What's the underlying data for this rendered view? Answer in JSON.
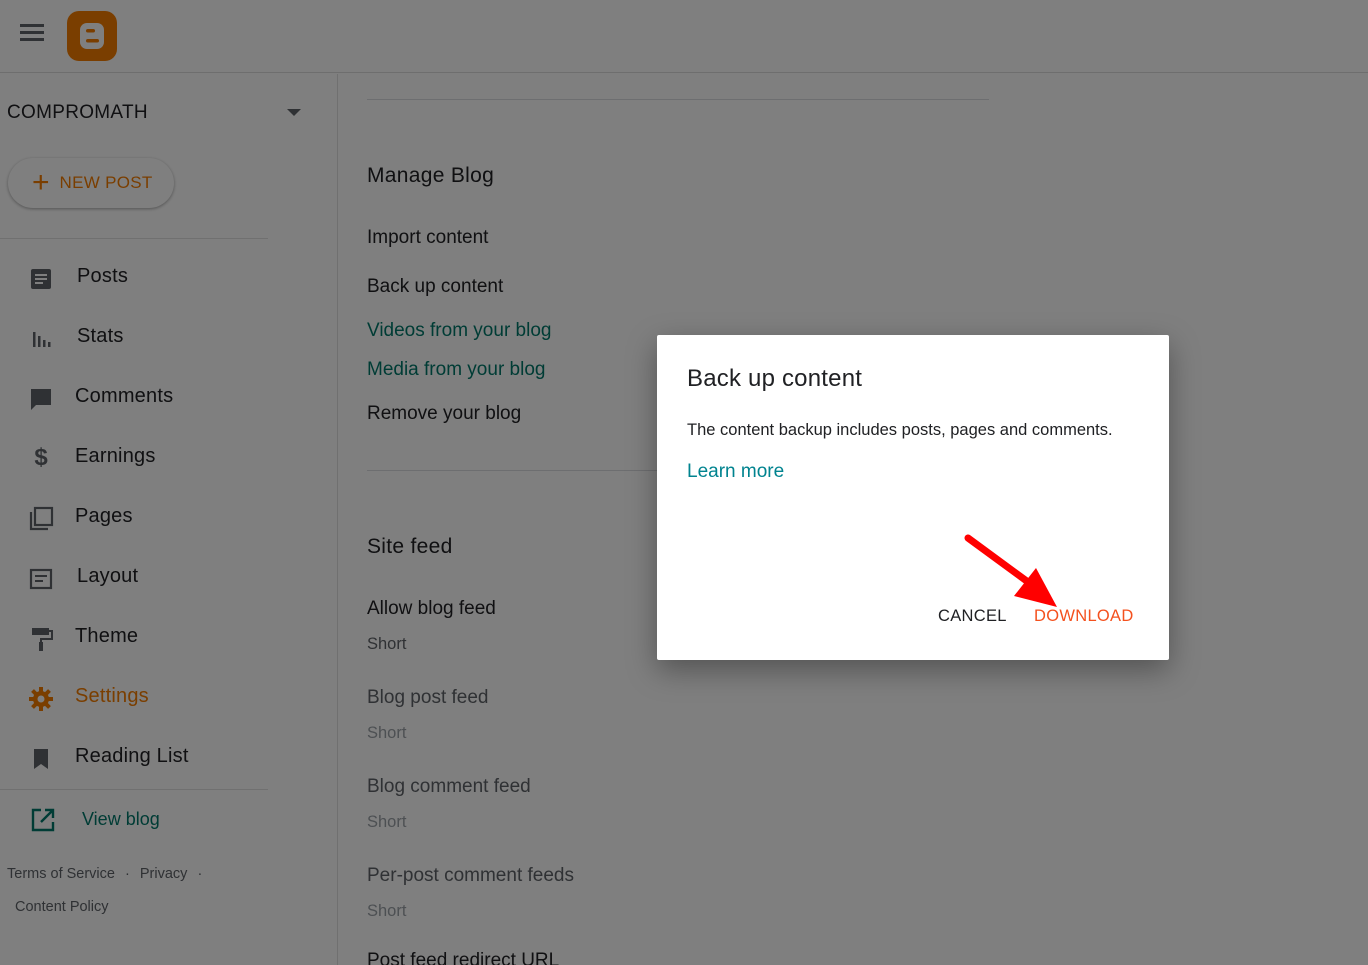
{
  "header": {
    "menu_icon": "hamburger-menu-icon",
    "logo_icon": "blogger-logo-icon"
  },
  "sidebar": {
    "blog_name": "COMPROMATH",
    "new_post_label": "NEW POST",
    "items": [
      {
        "label": "Posts",
        "icon": "posts-icon"
      },
      {
        "label": "Stats",
        "icon": "stats-icon"
      },
      {
        "label": "Comments",
        "icon": "comments-icon"
      },
      {
        "label": "Earnings",
        "icon": "dollar-icon"
      },
      {
        "label": "Pages",
        "icon": "pages-icon"
      },
      {
        "label": "Layout",
        "icon": "layout-icon"
      },
      {
        "label": "Theme",
        "icon": "paint-roller-icon"
      },
      {
        "label": "Settings",
        "icon": "gear-icon",
        "active": true
      },
      {
        "label": "Reading List",
        "icon": "bookmark-icon"
      }
    ],
    "view_blog_label": "View blog",
    "footer": {
      "terms": "Terms of Service",
      "privacy": "Privacy",
      "content_policy": "Content Policy",
      "separator": "·"
    }
  },
  "main": {
    "manage_blog": {
      "title": "Manage Blog",
      "import": "Import content",
      "backup": "Back up content",
      "videos": "Videos from your blog",
      "media": "Media from your blog",
      "remove": "Remove your blog"
    },
    "site_feed": {
      "title": "Site feed",
      "allow_blog_feed": {
        "label": "Allow blog feed",
        "value": "Short"
      },
      "blog_post_feed": {
        "label": "Blog post feed",
        "value": "Short"
      },
      "blog_comment_feed": {
        "label": "Blog comment feed",
        "value": "Short"
      },
      "per_post_comment_feeds": {
        "label": "Per-post comment feeds",
        "value": "Short"
      },
      "post_feed_redirect": {
        "label": "Post feed redirect URL"
      }
    }
  },
  "dialog": {
    "title": "Back up content",
    "body": "The content backup includes posts, pages and comments.",
    "learn_more": "Learn more",
    "cancel": "CANCEL",
    "download": "DOWNLOAD"
  },
  "colors": {
    "accent": "#f57d00",
    "link": "#00796b",
    "download": "#f4511e",
    "annotation_arrow": "#ff0000"
  }
}
